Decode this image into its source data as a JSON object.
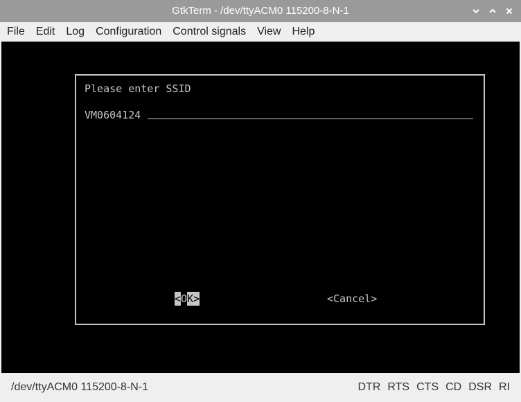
{
  "window": {
    "title": "GtkTerm - /dev/ttyACM0  115200-8-N-1",
    "controls": [
      "chevron-down-icon",
      "chevron-up-icon",
      "close-icon"
    ]
  },
  "menu": {
    "items": [
      "File",
      "Edit",
      "Log",
      "Configuration",
      "Control signals",
      "View",
      "Help"
    ]
  },
  "dialog": {
    "prompt": "Please enter SSID",
    "ssid_value": "VM0604124",
    "ok": {
      "open": "<",
      "highlight": "O",
      "rest": "K",
      "close": ">"
    },
    "cancel_label": "<Cancel>"
  },
  "status": {
    "port_settings": "/dev/ttyACM0  115200-8-N-1",
    "signals": [
      "DTR",
      "RTS",
      "CTS",
      "CD",
      "DSR",
      "RI"
    ]
  },
  "colors": {
    "titlebar": "#9a9a9a",
    "terminal_bg": "#000000",
    "terminal_fg": "#c7c7c7"
  }
}
